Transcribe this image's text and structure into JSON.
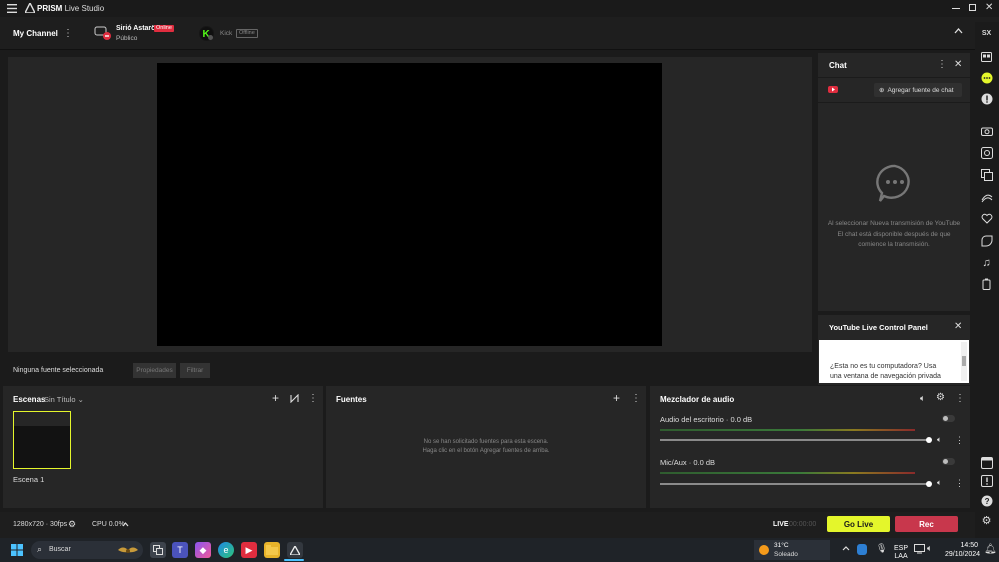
{
  "app": {
    "name_bold": "PRISM",
    "name_rest": "Live Studio"
  },
  "channel_bar": {
    "title": "My Channel",
    "channels": [
      {
        "name": "Sirió Astaröt",
        "status": "Online",
        "visibility": "Público"
      },
      {
        "name": "Kick",
        "status": "Offline"
      }
    ]
  },
  "properties_bar": {
    "no_source": "Ninguna fuente seleccionada",
    "properties_button": "Propiedades",
    "filters_button": "Filtrar"
  },
  "scenes": {
    "title": "Escenas",
    "collection": "Sin Título",
    "items": [
      {
        "label": "Escena 1"
      }
    ]
  },
  "sources": {
    "title": "Fuentes",
    "empty_line1": "No se han solicitado fuentes para esta escena.",
    "empty_line2": "Haga clic en el botón Agregar fuentes de arriba."
  },
  "mixer": {
    "title": "Mezclador de audio",
    "tracks": [
      {
        "name": "Audio del escritorio",
        "level": "0.0 dB",
        "volume": 1.0
      },
      {
        "name": "Mic/Aux",
        "level": "0.0 dB",
        "volume": 1.0
      }
    ]
  },
  "chat": {
    "title": "Chat",
    "add_source": "Agregar fuente de chat",
    "message": "Al seleccionar Nueva transmisión de YouTube El chat está disponible después de que comience la transmisión."
  },
  "ylcp": {
    "title": "YouTube Live Control Panel",
    "text_line1": "¿Esta no es tu computadora? Usa",
    "text_line2": "una ventana de navegación privada"
  },
  "status": {
    "resolution": "1280x720 · 30fps",
    "cpu": "CPU 0.0%",
    "live_label": "LIVE",
    "live_time": "00:00:00",
    "go_live": "Go Live",
    "rec": "Rec"
  },
  "taskbar": {
    "search": "Buscar",
    "weather_temp": "31°C",
    "weather_desc": "Soleado",
    "lang1": "ESP",
    "lang2": "LAA",
    "time": "14:50",
    "date": "29/10/2024"
  },
  "colors": {
    "accent_live": "#e4f62b",
    "accent_rec": "#c8374c",
    "online_badge": "#e02d3f",
    "scene_selected": "#e4f62b"
  }
}
